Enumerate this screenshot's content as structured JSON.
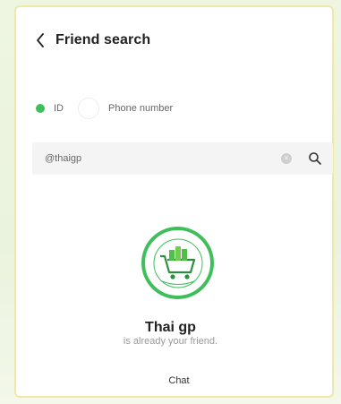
{
  "header": {
    "title": "Friend search"
  },
  "search_type": {
    "options": [
      {
        "label": "ID",
        "selected": true
      },
      {
        "label": "Phone number",
        "selected": false
      }
    ]
  },
  "search": {
    "value": "@thaigp"
  },
  "result": {
    "name": "Thai gp",
    "status": "is already your friend.",
    "action_label": "Chat"
  },
  "colors": {
    "accent": "#3ebf5b",
    "panel_border": "#f1e7a8",
    "background": "#e9f2dc"
  }
}
